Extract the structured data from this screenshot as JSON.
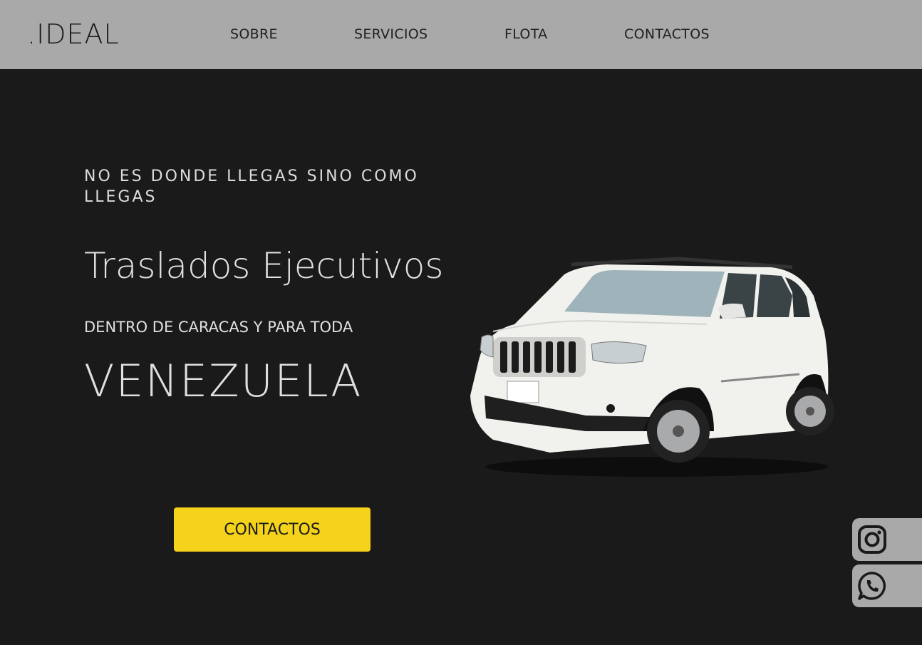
{
  "brand": {
    "logo": ".IDEAL"
  },
  "nav": {
    "items": [
      {
        "label": "SOBRE"
      },
      {
        "label": "SERVICIOS"
      },
      {
        "label": "FLOTA"
      },
      {
        "label": "CONTACTOS"
      }
    ]
  },
  "hero": {
    "tagline": "NO ES DONDE LLEGAS SINO COMO LLEGAS",
    "headline": "Traslados Ejecutivos",
    "subline": "DENTRO DE CARACAS Y PARA TODA",
    "country": "VENEZUELA",
    "cta_label": "CONTACTOS"
  },
  "social": [
    {
      "icon": "instagram-icon"
    },
    {
      "icon": "whatsapp-icon"
    }
  ],
  "colors": {
    "navbar_bg": "#a9a9a9",
    "page_bg": "#1a1a1a",
    "accent": "#f5d31a",
    "text_light": "#e0e0e0"
  }
}
